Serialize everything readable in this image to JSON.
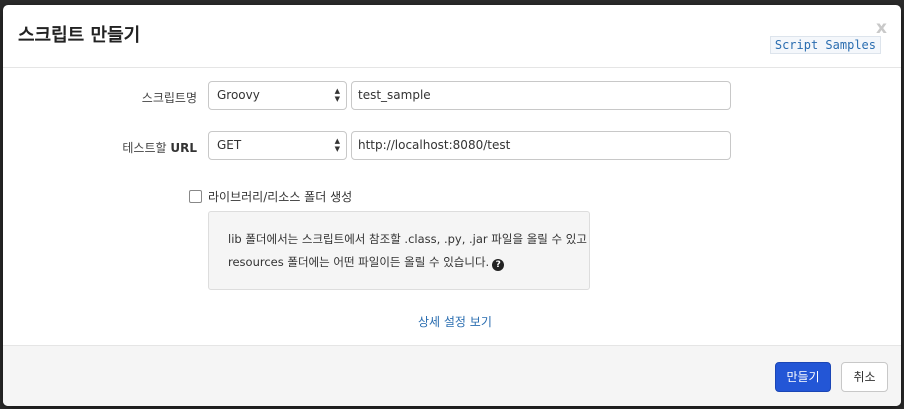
{
  "modal": {
    "title": "스크립트 만들기",
    "close_label": "x",
    "samples_link": "Script Samples"
  },
  "form": {
    "script_name": {
      "label": "스크립트명",
      "type_value": "Groovy",
      "name_value": "test_sample"
    },
    "test_url": {
      "label_prefix": "테스트할",
      "label_bold": "URL",
      "method_value": "GET",
      "url_value": "http://localhost:8080/test"
    },
    "lib_checkbox_label": "라이브러리/리소스 폴더 생성",
    "lib_checkbox_checked": false,
    "info_line1": "lib 폴더에서는 스크립트에서 참조할 .class, .py, .jar 파일을 올릴 수 있고",
    "info_line2": "resources 폴더에는 어떤 파일이든 올릴 수 있습니다.",
    "help_icon": "?",
    "advanced_link": "상세 설정 보기"
  },
  "footer": {
    "create_button": "만들기",
    "cancel_button": "취소"
  },
  "colors": {
    "primary": "#2356d6",
    "link": "#2a6db0"
  }
}
